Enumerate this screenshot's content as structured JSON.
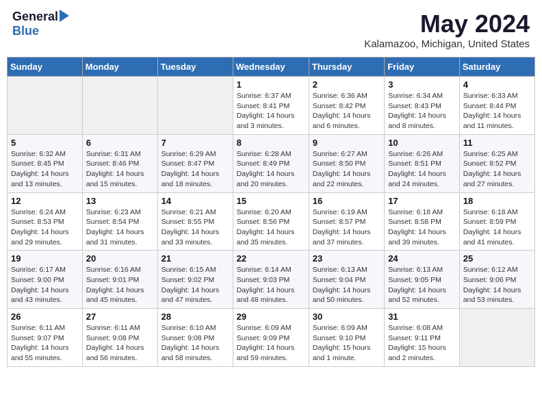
{
  "header": {
    "logo_general": "General",
    "logo_blue": "Blue",
    "title": "May 2024",
    "location": "Kalamazoo, Michigan, United States"
  },
  "weekdays": [
    "Sunday",
    "Monday",
    "Tuesday",
    "Wednesday",
    "Thursday",
    "Friday",
    "Saturday"
  ],
  "weeks": [
    [
      {
        "day": "",
        "info": ""
      },
      {
        "day": "",
        "info": ""
      },
      {
        "day": "",
        "info": ""
      },
      {
        "day": "1",
        "info": "Sunrise: 6:37 AM\nSunset: 8:41 PM\nDaylight: 14 hours\nand 3 minutes."
      },
      {
        "day": "2",
        "info": "Sunrise: 6:36 AM\nSunset: 8:42 PM\nDaylight: 14 hours\nand 6 minutes."
      },
      {
        "day": "3",
        "info": "Sunrise: 6:34 AM\nSunset: 8:43 PM\nDaylight: 14 hours\nand 8 minutes."
      },
      {
        "day": "4",
        "info": "Sunrise: 6:33 AM\nSunset: 8:44 PM\nDaylight: 14 hours\nand 11 minutes."
      }
    ],
    [
      {
        "day": "5",
        "info": "Sunrise: 6:32 AM\nSunset: 8:45 PM\nDaylight: 14 hours\nand 13 minutes."
      },
      {
        "day": "6",
        "info": "Sunrise: 6:31 AM\nSunset: 8:46 PM\nDaylight: 14 hours\nand 15 minutes."
      },
      {
        "day": "7",
        "info": "Sunrise: 6:29 AM\nSunset: 8:47 PM\nDaylight: 14 hours\nand 18 minutes."
      },
      {
        "day": "8",
        "info": "Sunrise: 6:28 AM\nSunset: 8:49 PM\nDaylight: 14 hours\nand 20 minutes."
      },
      {
        "day": "9",
        "info": "Sunrise: 6:27 AM\nSunset: 8:50 PM\nDaylight: 14 hours\nand 22 minutes."
      },
      {
        "day": "10",
        "info": "Sunrise: 6:26 AM\nSunset: 8:51 PM\nDaylight: 14 hours\nand 24 minutes."
      },
      {
        "day": "11",
        "info": "Sunrise: 6:25 AM\nSunset: 8:52 PM\nDaylight: 14 hours\nand 27 minutes."
      }
    ],
    [
      {
        "day": "12",
        "info": "Sunrise: 6:24 AM\nSunset: 8:53 PM\nDaylight: 14 hours\nand 29 minutes."
      },
      {
        "day": "13",
        "info": "Sunrise: 6:23 AM\nSunset: 8:54 PM\nDaylight: 14 hours\nand 31 minutes."
      },
      {
        "day": "14",
        "info": "Sunrise: 6:21 AM\nSunset: 8:55 PM\nDaylight: 14 hours\nand 33 minutes."
      },
      {
        "day": "15",
        "info": "Sunrise: 6:20 AM\nSunset: 8:56 PM\nDaylight: 14 hours\nand 35 minutes."
      },
      {
        "day": "16",
        "info": "Sunrise: 6:19 AM\nSunset: 8:57 PM\nDaylight: 14 hours\nand 37 minutes."
      },
      {
        "day": "17",
        "info": "Sunrise: 6:18 AM\nSunset: 8:58 PM\nDaylight: 14 hours\nand 39 minutes."
      },
      {
        "day": "18",
        "info": "Sunrise: 6:18 AM\nSunset: 8:59 PM\nDaylight: 14 hours\nand 41 minutes."
      }
    ],
    [
      {
        "day": "19",
        "info": "Sunrise: 6:17 AM\nSunset: 9:00 PM\nDaylight: 14 hours\nand 43 minutes."
      },
      {
        "day": "20",
        "info": "Sunrise: 6:16 AM\nSunset: 9:01 PM\nDaylight: 14 hours\nand 45 minutes."
      },
      {
        "day": "21",
        "info": "Sunrise: 6:15 AM\nSunset: 9:02 PM\nDaylight: 14 hours\nand 47 minutes."
      },
      {
        "day": "22",
        "info": "Sunrise: 6:14 AM\nSunset: 9:03 PM\nDaylight: 14 hours\nand 48 minutes."
      },
      {
        "day": "23",
        "info": "Sunrise: 6:13 AM\nSunset: 9:04 PM\nDaylight: 14 hours\nand 50 minutes."
      },
      {
        "day": "24",
        "info": "Sunrise: 6:13 AM\nSunset: 9:05 PM\nDaylight: 14 hours\nand 52 minutes."
      },
      {
        "day": "25",
        "info": "Sunrise: 6:12 AM\nSunset: 9:06 PM\nDaylight: 14 hours\nand 53 minutes."
      }
    ],
    [
      {
        "day": "26",
        "info": "Sunrise: 6:11 AM\nSunset: 9:07 PM\nDaylight: 14 hours\nand 55 minutes."
      },
      {
        "day": "27",
        "info": "Sunrise: 6:11 AM\nSunset: 9:08 PM\nDaylight: 14 hours\nand 56 minutes."
      },
      {
        "day": "28",
        "info": "Sunrise: 6:10 AM\nSunset: 9:08 PM\nDaylight: 14 hours\nand 58 minutes."
      },
      {
        "day": "29",
        "info": "Sunrise: 6:09 AM\nSunset: 9:09 PM\nDaylight: 14 hours\nand 59 minutes."
      },
      {
        "day": "30",
        "info": "Sunrise: 6:09 AM\nSunset: 9:10 PM\nDaylight: 15 hours\nand 1 minute."
      },
      {
        "day": "31",
        "info": "Sunrise: 6:08 AM\nSunset: 9:11 PM\nDaylight: 15 hours\nand 2 minutes."
      },
      {
        "day": "",
        "info": ""
      }
    ]
  ]
}
